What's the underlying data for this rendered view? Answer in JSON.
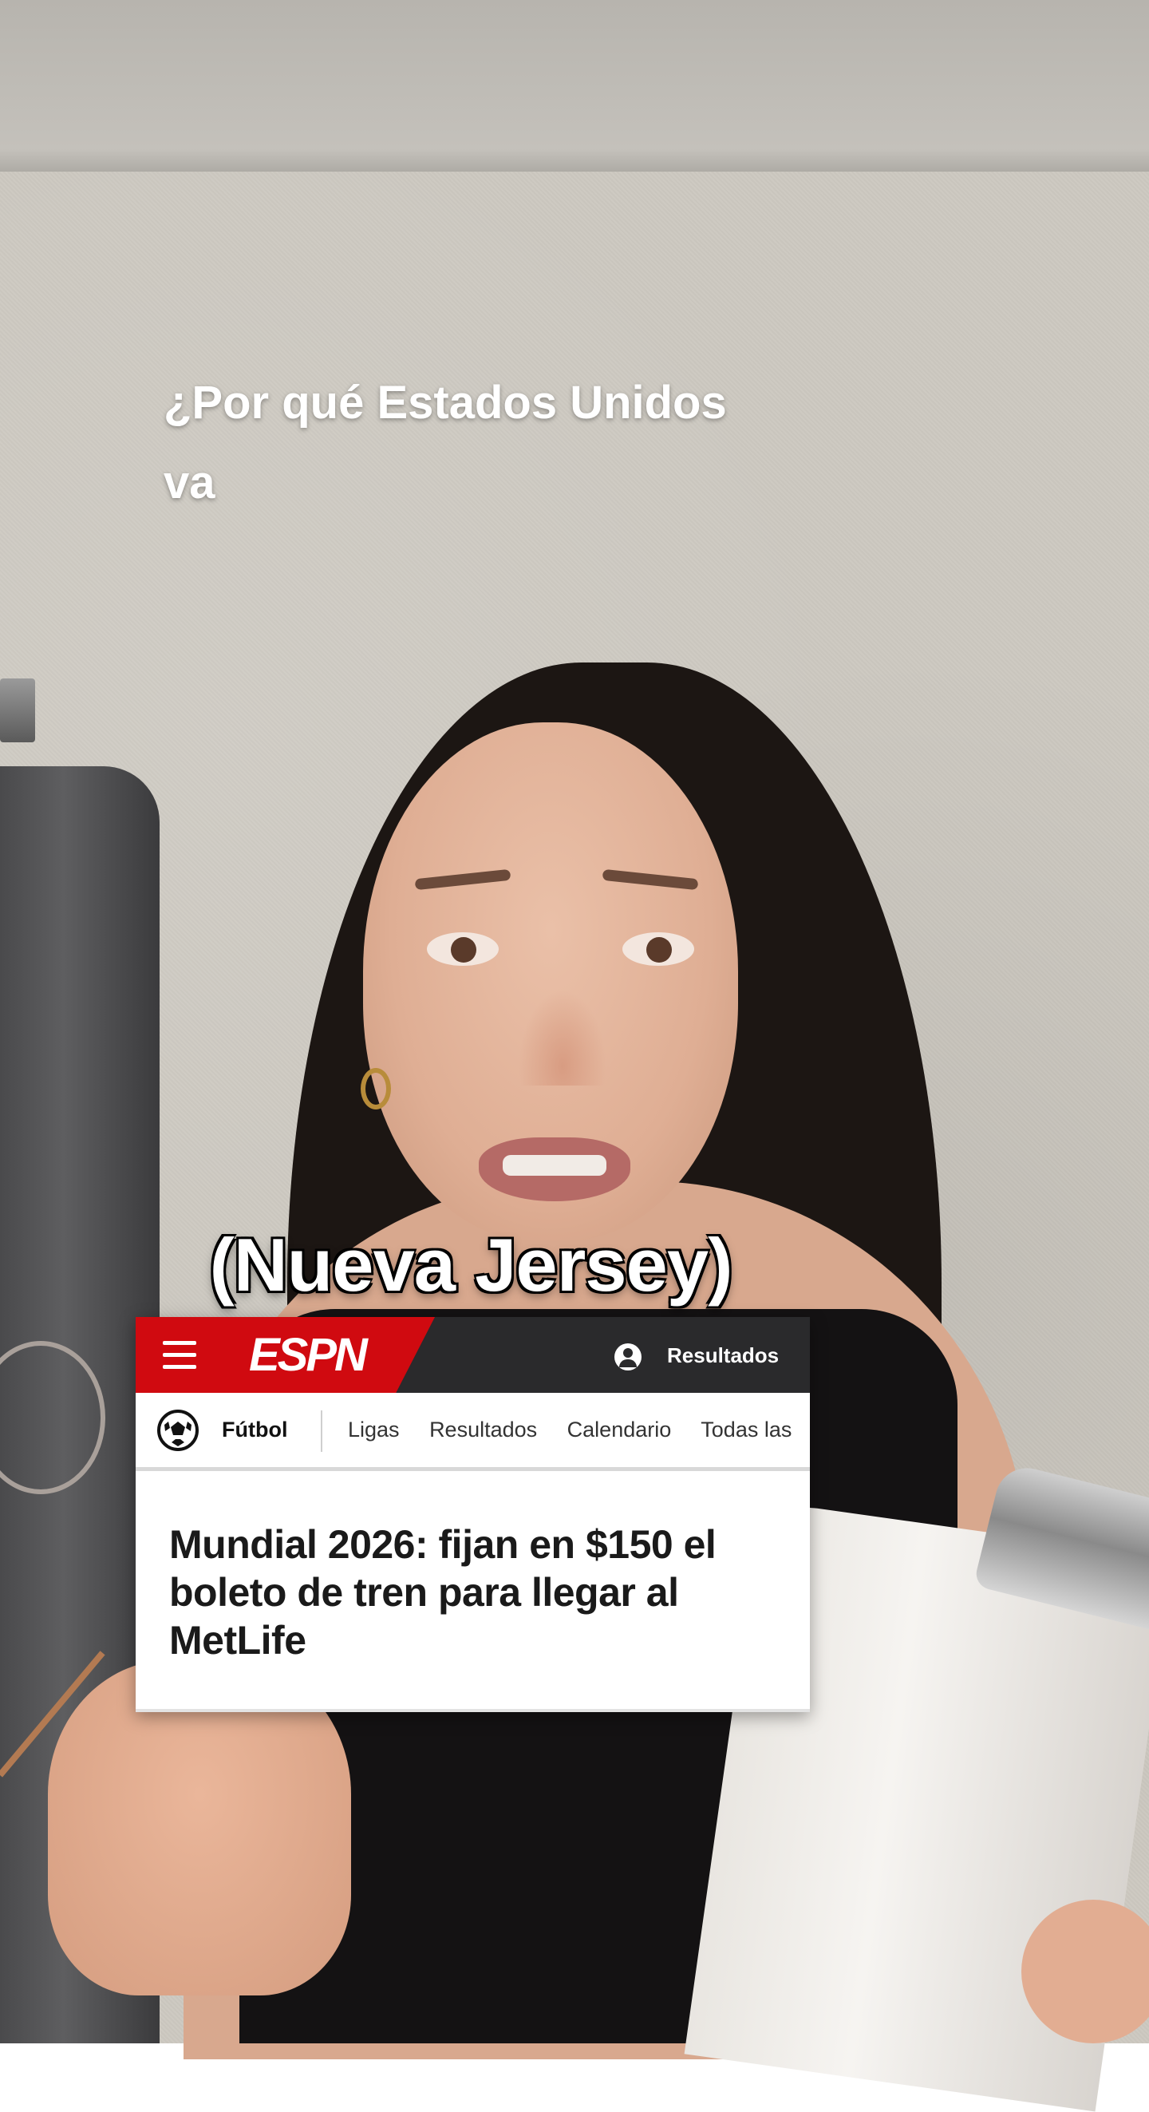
{
  "caption": {
    "line1": "¿Por qué Estados Unidos",
    "line2": "va",
    "bubble": "(Nueva Jersey)"
  },
  "espn": {
    "logo": "ESPN",
    "header_results": "Resultados",
    "sport": "Fútbol",
    "nav_items": [
      "Ligas",
      "Resultados",
      "Calendario",
      "Todas las"
    ],
    "headline": "Mundial 2026: fijan en $150 el boleto de tren para llegar al MetLife",
    "colors": {
      "brand_red": "#d00a10",
      "header_dark": "#2a2a2c"
    },
    "icons": [
      "menu-icon",
      "user-icon",
      "soccer-ball-icon"
    ]
  }
}
